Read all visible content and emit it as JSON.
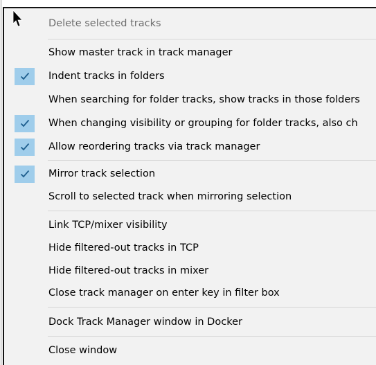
{
  "menu": {
    "items": [
      {
        "label": "Delete selected tracks",
        "checked": false,
        "disabled": true
      },
      {
        "label": "Show master track in track manager",
        "checked": false,
        "disabled": false
      },
      {
        "label": "Indent tracks in folders",
        "checked": true,
        "disabled": false
      },
      {
        "label": "When searching for folder tracks, show tracks in those folders",
        "checked": false,
        "disabled": false
      },
      {
        "label": "When changing visibility or grouping for folder tracks, also ch",
        "checked": true,
        "disabled": false
      },
      {
        "label": "Allow reordering tracks via track manager",
        "checked": true,
        "disabled": false
      },
      {
        "label": "Mirror track selection",
        "checked": true,
        "disabled": false
      },
      {
        "label": "Scroll to selected track when mirroring selection",
        "checked": false,
        "disabled": false
      },
      {
        "label": "Link TCP/mixer visibility",
        "checked": false,
        "disabled": false
      },
      {
        "label": "Hide filtered-out tracks in TCP",
        "checked": false,
        "disabled": false
      },
      {
        "label": "Hide filtered-out tracks in mixer",
        "checked": false,
        "disabled": false
      },
      {
        "label": "Close track manager on enter key in filter box",
        "checked": false,
        "disabled": false
      },
      {
        "label": "Dock Track Manager window in Docker",
        "checked": false,
        "disabled": false
      },
      {
        "label": "Close window",
        "checked": false,
        "disabled": false
      }
    ]
  },
  "icons": {
    "check": "checkmark-icon",
    "cursor": "mouse-pointer-icon"
  },
  "colors": {
    "menu_background": "#f2f2f2",
    "check_highlight": "#9fcdeb",
    "check_mark": "#1f5f8f",
    "disabled_text": "#6d6d6d",
    "separator": "#d6d6d6"
  }
}
